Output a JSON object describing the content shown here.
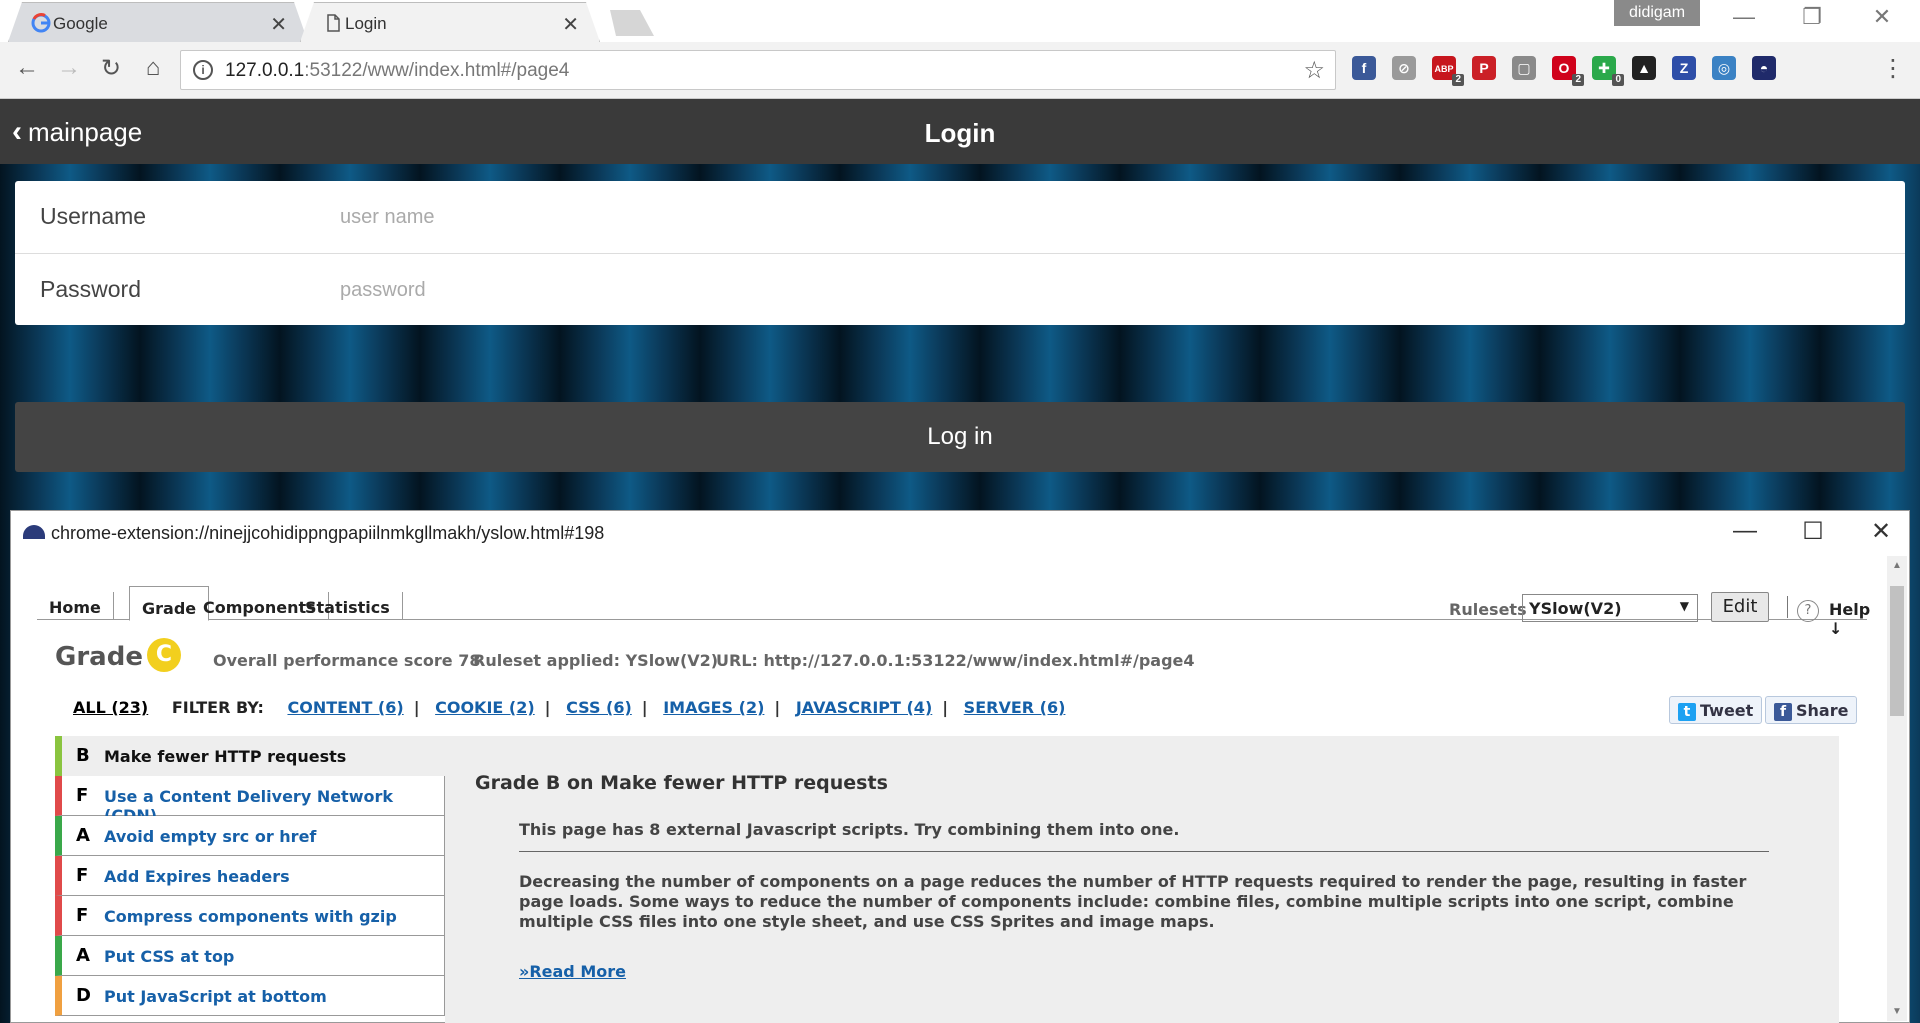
{
  "browser": {
    "tabs": [
      {
        "title": "Google",
        "icon": "google-icon"
      },
      {
        "title": "Login",
        "icon": "document-icon"
      }
    ],
    "profile": "didigam",
    "url_host": "127.0.0.1",
    "url_rest": ":53122/www/index.html#/page4",
    "extensions": [
      {
        "name": "facebook-ext-icon",
        "label": "f",
        "color": "#3b5998"
      },
      {
        "name": "disabled-ext-icon",
        "label": "⊘",
        "color": "#9a9a9a"
      },
      {
        "name": "adblock-ext-icon",
        "label": "ABP",
        "color": "#c7161d",
        "badge": "2"
      },
      {
        "name": "pinterest-ext-icon",
        "label": "P",
        "color": "#cb2027"
      },
      {
        "name": "grey-ext-icon",
        "label": "▢",
        "color": "#8a8a8a"
      },
      {
        "name": "opera-ext-icon",
        "label": "O",
        "color": "#d0021b",
        "badge": "2"
      },
      {
        "name": "green-ext-icon",
        "label": "✚",
        "color": "#2ba94b",
        "badge": "0"
      },
      {
        "name": "rocket-ext-icon",
        "label": "▲",
        "color": "#222222"
      },
      {
        "name": "z-ext-icon",
        "label": "Z",
        "color": "#2e4ea8"
      },
      {
        "name": "blue-circle-ext-icon",
        "label": "◎",
        "color": "#3b82c4"
      },
      {
        "name": "yslow-ext-icon",
        "label": "◓",
        "color": "#1f2a6a"
      }
    ]
  },
  "app": {
    "back_label": "mainpage",
    "title": "Login",
    "username_label": "Username",
    "username_placeholder": "user name",
    "password_label": "Password",
    "password_placeholder": "password",
    "login_button": "Log in"
  },
  "popup": {
    "url": "chrome-extension://ninejjcohidippngpapiilnmkgllmakh/yslow.html#198"
  },
  "yslow": {
    "tabs": [
      "Home",
      "Grade",
      "Components",
      "Statistics"
    ],
    "active_tab": "Grade",
    "rulesets_label": "Rulesets",
    "ruleset_value": "YSlow(V2)",
    "edit_label": "Edit",
    "help_label": "Help ↓",
    "grade_title": "Grade",
    "grade_letter": "C",
    "grade_color": "#f2cf1e",
    "score_text": "Overall performance score 78",
    "ruleset_text": "Ruleset applied: YSlow(V2)",
    "url_text": "URL: http://127.0.0.1:53122/www/index.html#/page4",
    "filter_all": "ALL (23)",
    "filter_by": "FILTER BY:",
    "filters": [
      "CONTENT (6)",
      "COOKIE (2)",
      "CSS (6)",
      "IMAGES (2)",
      "JAVASCRIPT (4)",
      "SERVER (6)"
    ],
    "tweet_label": "Tweet",
    "share_label": "Share",
    "rules": [
      {
        "grade": "B",
        "title": "Make fewer HTTP requests",
        "color": "#8ac43f"
      },
      {
        "grade": "F",
        "title": "Use a Content Delivery Network (CDN)",
        "color": "#e04a4a"
      },
      {
        "grade": "A",
        "title": "Avoid empty src or href",
        "color": "#3aa84a"
      },
      {
        "grade": "F",
        "title": "Add Expires headers",
        "color": "#e04a4a"
      },
      {
        "grade": "F",
        "title": "Compress components with gzip",
        "color": "#e04a4a"
      },
      {
        "grade": "A",
        "title": "Put CSS at top",
        "color": "#3aa84a"
      },
      {
        "grade": "D",
        "title": "Put JavaScript at bottom",
        "color": "#f0a040"
      }
    ],
    "detail_title": "Grade B on Make fewer HTTP requests",
    "detail_summary": "This page has 8 external Javascript scripts. Try combining them into one.",
    "detail_desc": "Decreasing the number of components on a page reduces the number of HTTP requests required to render the page, resulting in faster page loads. Some ways to reduce the number of components include: combine files, combine multiple scripts into one script, combine multiple CSS files into one style sheet, and use CSS Sprites and image maps.",
    "read_more": "»Read More"
  }
}
